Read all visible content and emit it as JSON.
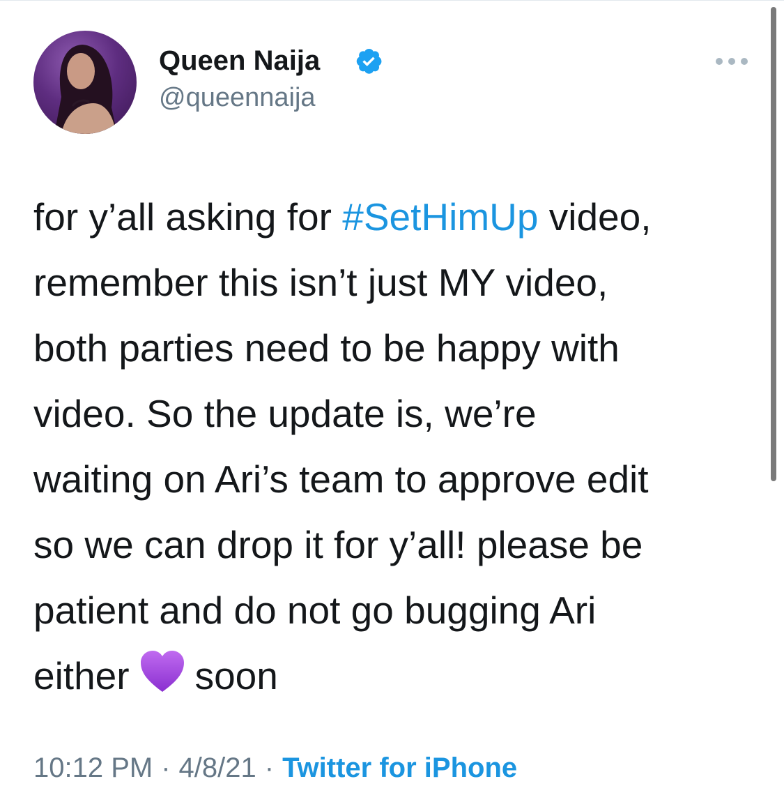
{
  "user": {
    "display_name": "Queen Naija",
    "handle": "@queennaija",
    "verified": true
  },
  "tweet": {
    "lines": [
      {
        "before": "for y’all asking for ",
        "hashtag": "#SetHimUp",
        "after": " video,"
      },
      {
        "text": "remember this isn’t just MY video,"
      },
      {
        "text": "both parties need to be happy with"
      },
      {
        "text": "video. So the update is, we’re"
      },
      {
        "text": "waiting on Ari’s team to approve edit"
      },
      {
        "text": "so we can drop it for y’all! please be"
      },
      {
        "text": "patient and do not go bugging Ari"
      },
      {
        "before": "either",
        "emoji": "purple-heart-icon",
        "after": "soon"
      }
    ]
  },
  "meta": {
    "time": "10:12 PM",
    "separator": "·",
    "date": "4/8/21",
    "source": "Twitter for iPhone"
  },
  "colors": {
    "text": "#14171a",
    "secondary": "#657786",
    "link": "#1b95e0",
    "verified": "#1da1f2",
    "heart": "#9b42d8"
  },
  "icons": {
    "verified": "verified-badge-icon",
    "more": "more-options-icon",
    "emoji": "purple-heart-icon"
  }
}
